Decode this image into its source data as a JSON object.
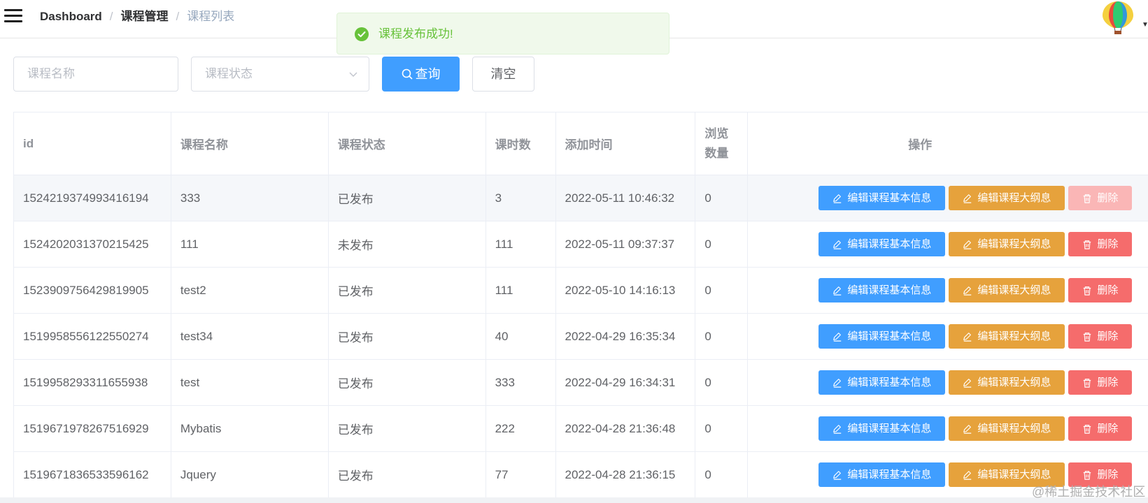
{
  "navbar": {
    "breadcrumb": [
      "Dashboard",
      "课程管理",
      "课程列表"
    ]
  },
  "toast": {
    "message": "课程发布成功!",
    "color": "#67c23a"
  },
  "filters": {
    "name_placeholder": "课程名称",
    "status_placeholder": "课程状态",
    "query_label": "查询",
    "clear_label": "清空"
  },
  "table": {
    "headers": {
      "id": "id",
      "name": "课程名称",
      "status": "课程状态",
      "hours": "课时数",
      "time": "添加时间",
      "views": "浏览数量",
      "ops": "操作"
    },
    "action_labels": {
      "edit": "编辑课程基本信息",
      "outline": "编辑课程大纲息",
      "delete": "删除"
    },
    "rows": [
      {
        "id": "1524219374993416194",
        "name": "333",
        "status": "已发布",
        "hours": "3",
        "time": "2022-05-11 10:46:32",
        "views": "0"
      },
      {
        "id": "1524202031370215425",
        "name": "111",
        "status": "未发布",
        "hours": "111",
        "time": "2022-05-11 09:37:37",
        "views": "0"
      },
      {
        "id": "1523909756429819905",
        "name": "test2",
        "status": "已发布",
        "hours": "111",
        "time": "2022-05-10 14:16:13",
        "views": "0"
      },
      {
        "id": "1519958556122550274",
        "name": "test34",
        "status": "已发布",
        "hours": "40",
        "time": "2022-04-29 16:35:34",
        "views": "0"
      },
      {
        "id": "1519958293311655938",
        "name": "test",
        "status": "已发布",
        "hours": "333",
        "time": "2022-04-29 16:34:31",
        "views": "0"
      },
      {
        "id": "1519671978267516929",
        "name": "Mybatis",
        "status": "已发布",
        "hours": "222",
        "time": "2022-04-28 21:36:48",
        "views": "0"
      },
      {
        "id": "1519671836533596162",
        "name": "Jquery",
        "status": "已发布",
        "hours": "77",
        "time": "2022-04-28 21:36:15",
        "views": "0"
      }
    ]
  },
  "watermark": "@稀土掘金技术社区",
  "colors": {
    "primary": "#409eff",
    "warning": "#e6a23c",
    "danger": "#f56c6c",
    "success_bg": "#f0f9eb"
  }
}
